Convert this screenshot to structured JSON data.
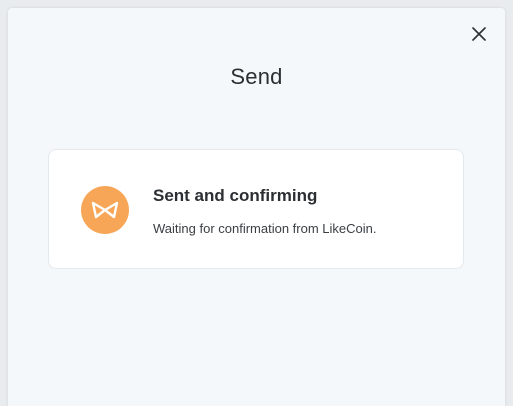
{
  "dialog": {
    "title": "Send",
    "close_icon": "close-icon"
  },
  "status_card": {
    "icon": "likecoin-icon",
    "icon_color": "#f7a658",
    "title": "Sent and confirming",
    "description": "Waiting for confirmation from LikeCoin."
  }
}
